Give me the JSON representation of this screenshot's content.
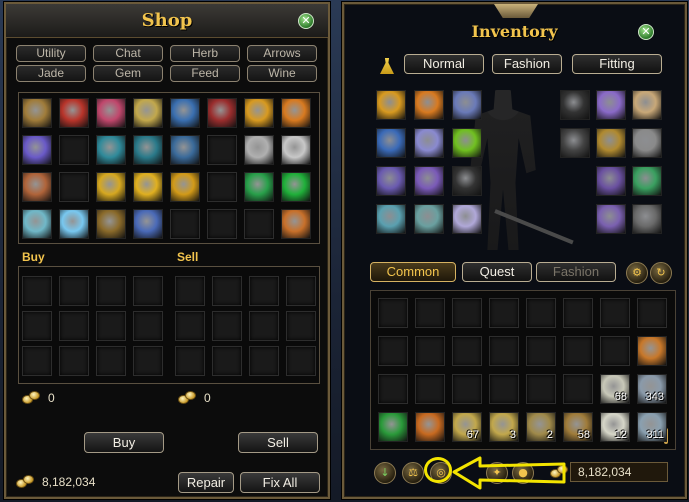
{
  "shop": {
    "title": "Shop",
    "tabs_row1": [
      "Utility",
      "Chat",
      "Herb",
      "Arrows"
    ],
    "tabs_row2": [
      "Jade",
      "Gem",
      "Feed",
      "Wine"
    ],
    "buy_label": "Buy",
    "sell_label": "Sell",
    "buy_total": "0",
    "sell_total": "0",
    "buy_button": "Buy",
    "sell_button": "Sell",
    "gold": "8,182,034",
    "repair_button": "Repair",
    "fix_all_button": "Fix All",
    "items": [
      {
        "row": 0,
        "col": 0,
        "color": "#a07c3a",
        "icon": "scroll-item-icon"
      },
      {
        "row": 0,
        "col": 1,
        "color": "#b8342a",
        "icon": "fire-item-icon"
      },
      {
        "row": 0,
        "col": 2,
        "color": "#c0476c",
        "icon": "doll-item-icon"
      },
      {
        "row": 0,
        "col": 3,
        "color": "#c2a84c",
        "icon": "parchment-item-icon"
      },
      {
        "row": 0,
        "col": 4,
        "color": "#3a6fb0",
        "icon": "flute-item-icon"
      },
      {
        "row": 0,
        "col": 5,
        "color": "#9a2d2d",
        "icon": "firecracker-item-icon"
      },
      {
        "row": 0,
        "col": 6,
        "color": "#d89a20",
        "icon": "talisman-item-icon"
      },
      {
        "row": 0,
        "col": 7,
        "color": "#d87a20",
        "icon": "talisman-item-icon"
      },
      {
        "row": 1,
        "col": 0,
        "color": "#6a5ac8",
        "icon": "key-item-icon"
      },
      {
        "row": 1,
        "col": 2,
        "color": "#2f8a9a",
        "icon": "cloth-item-icon"
      },
      {
        "row": 1,
        "col": 3,
        "color": "#2a7a8a",
        "icon": "cloth-item-icon"
      },
      {
        "row": 1,
        "col": 4,
        "color": "#3a6a9a",
        "icon": "seal-item-icon"
      },
      {
        "row": 1,
        "col": 6,
        "color": "#b0b0b0",
        "icon": "rune-item-icon"
      },
      {
        "row": 1,
        "col": 7,
        "color": "#c8c8c8",
        "icon": "rune-item-icon"
      },
      {
        "row": 2,
        "col": 0,
        "color": "#b0643a",
        "icon": "bag-item-icon"
      },
      {
        "row": 2,
        "col": 2,
        "color": "#d6a820",
        "icon": "charm-item-icon"
      },
      {
        "row": 2,
        "col": 3,
        "color": "#e0b020",
        "icon": "charm-item-icon"
      },
      {
        "row": 2,
        "col": 4,
        "color": "#d29a18",
        "icon": "medal-item-icon"
      },
      {
        "row": 2,
        "col": 6,
        "color": "#28a04a",
        "icon": "jade-item-icon"
      },
      {
        "row": 2,
        "col": 7,
        "color": "#20b03a",
        "icon": "jade-item-icon"
      },
      {
        "row": 3,
        "col": 0,
        "color": "#70b8c8",
        "icon": "portrait-item-icon"
      },
      {
        "row": 3,
        "col": 1,
        "color": "#78c8f0",
        "icon": "crystal-item-icon"
      },
      {
        "row": 3,
        "col": 2,
        "color": "#8a6a2a",
        "icon": "box-item-icon"
      },
      {
        "row": 3,
        "col": 3,
        "color": "#4a6ab8",
        "icon": "book-item-icon"
      },
      {
        "row": 3,
        "col": 7,
        "color": "#c8702a",
        "icon": "map-item-icon"
      }
    ]
  },
  "inventory": {
    "title": "Inventory",
    "view_tabs": [
      "Normal",
      "Fashion",
      "Fitting"
    ],
    "bag_tabs": [
      "Common",
      "Quest",
      "Fashion"
    ],
    "gold": "8,182,034",
    "equip_left": [
      {
        "row": 0,
        "col": 0,
        "color": "#d89a20"
      },
      {
        "row": 0,
        "col": 1,
        "color": "#d87a20"
      },
      {
        "row": 0,
        "col": 2,
        "color": "#6a7ab8"
      },
      {
        "row": 1,
        "col": 0,
        "color": "#3a6ab8"
      },
      {
        "row": 1,
        "col": 1,
        "color": "#8a8ad0"
      },
      {
        "row": 1,
        "col": 2,
        "color": "#70c020"
      },
      {
        "row": 2,
        "col": 0,
        "color": "#6a5ab0"
      },
      {
        "row": 2,
        "col": 1,
        "color": "#7a5ab8"
      },
      {
        "row": 2,
        "col": 2,
        "color": "#333333"
      },
      {
        "row": 3,
        "col": 0,
        "color": "#5aa0b0"
      },
      {
        "row": 3,
        "col": 1,
        "color": "#6aa0a0"
      },
      {
        "row": 3,
        "col": 2,
        "color": "#b0a8d8"
      }
    ],
    "equip_right": [
      {
        "row": 0,
        "col": 0,
        "color": "#333333"
      },
      {
        "row": 0,
        "col": 1,
        "color": "#8a6ac8"
      },
      {
        "row": 0,
        "col": 2,
        "color": "#c8a878"
      },
      {
        "row": 1,
        "col": 0,
        "color": "#444444"
      },
      {
        "row": 1,
        "col": 1,
        "color": "#b08a30"
      },
      {
        "row": 1,
        "col": 2,
        "color": "#8a8a8a"
      },
      {
        "row": 2,
        "col": 1,
        "color": "#6a50a0"
      },
      {
        "row": 2,
        "col": 2,
        "color": "#3aa060"
      },
      {
        "row": 3,
        "col": 1,
        "color": "#7a60b0"
      },
      {
        "row": 3,
        "col": 2,
        "color": "#6a6a6a"
      }
    ],
    "bag_items": [
      {
        "row": 1,
        "col": 7,
        "color": "#c8782a",
        "qty": ""
      },
      {
        "row": 2,
        "col": 6,
        "color": "#c8c8b8",
        "qty": "68"
      },
      {
        "row": 2,
        "col": 7,
        "color": "#8a9aaa",
        "qty": "343"
      },
      {
        "row": 3,
        "col": 0,
        "color": "#2a9a3a",
        "qty": ""
      },
      {
        "row": 3,
        "col": 1,
        "color": "#c86a20",
        "qty": ""
      },
      {
        "row": 3,
        "col": 2,
        "color": "#c2a84c",
        "qty": "67"
      },
      {
        "row": 3,
        "col": 3,
        "color": "#c2a84c",
        "qty": "3"
      },
      {
        "row": 3,
        "col": 4,
        "color": "#a08a4a",
        "qty": "2"
      },
      {
        "row": 3,
        "col": 5,
        "color": "#a07c3a",
        "qty": "58"
      },
      {
        "row": 3,
        "col": 6,
        "color": "#d6d6c8",
        "qty": "12"
      },
      {
        "row": 3,
        "col": 7,
        "color": "#8aa0b0",
        "qty": "311"
      }
    ]
  }
}
